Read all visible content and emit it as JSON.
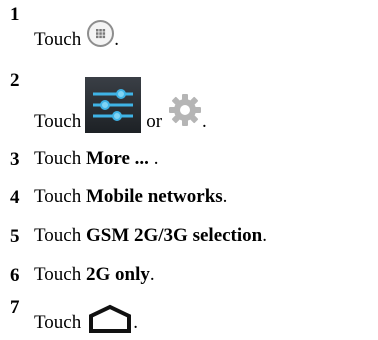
{
  "steps": [
    {
      "num": "1",
      "pre": "Touch",
      "bold": "",
      "post": ".",
      "icon": "apps-icon"
    },
    {
      "num": "2",
      "pre": "Touch",
      "bold": "",
      "mid": "or",
      "post": ".",
      "icon": "settings-icon",
      "icon2": "gear-icon"
    },
    {
      "num": "3",
      "pre": "Touch ",
      "bold": "More ...",
      "post": " ."
    },
    {
      "num": "4",
      "pre": "Touch ",
      "bold": "Mobile networks",
      "post": "."
    },
    {
      "num": "5",
      "pre": "Touch ",
      "bold": "GSM 2G/3G selection",
      "post": "."
    },
    {
      "num": "6",
      "pre": "Touch ",
      "bold": "2G only",
      "post": "."
    },
    {
      "num": "7",
      "pre": "Touch",
      "bold": "",
      "post": ".",
      "icon": "home-icon"
    }
  ],
  "colors": {
    "text": "#000000",
    "icon_gray": "#8e8e8e",
    "settings_blue": "#3fb3e6"
  }
}
